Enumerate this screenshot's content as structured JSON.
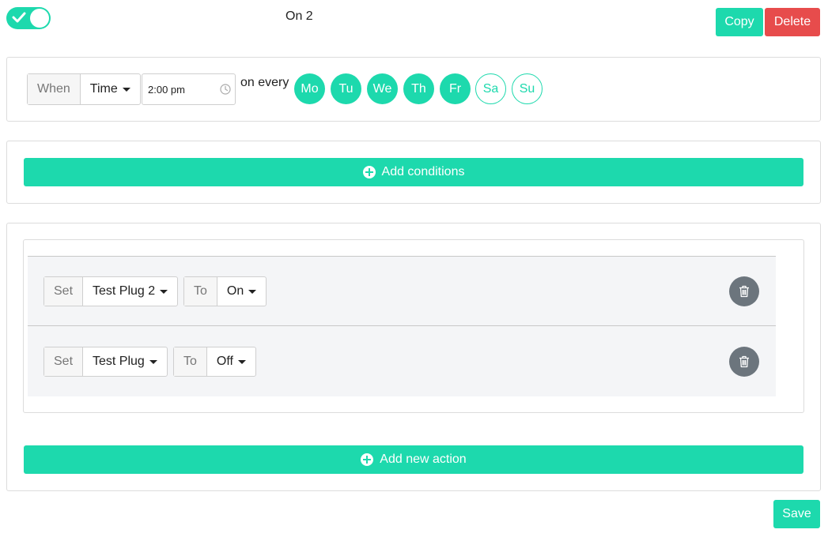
{
  "header": {
    "enabled": true,
    "rule_name": "On 2",
    "copy_label": "Copy",
    "delete_label": "Delete"
  },
  "trigger": {
    "when_label": "When",
    "type_value": "Time",
    "time_value": "2:00 pm",
    "on_every_label": "on every",
    "days": [
      {
        "label": "Mo",
        "selected": true
      },
      {
        "label": "Tu",
        "selected": true
      },
      {
        "label": "We",
        "selected": true
      },
      {
        "label": "Th",
        "selected": true
      },
      {
        "label": "Fr",
        "selected": true
      },
      {
        "label": "Sa",
        "selected": false
      },
      {
        "label": "Su",
        "selected": false
      }
    ]
  },
  "conditions": {
    "add_label": "Add conditions"
  },
  "actions": {
    "items": [
      {
        "set_label": "Set",
        "device": "Test Plug 2",
        "to_label": "To",
        "state": "On"
      },
      {
        "set_label": "Set",
        "device": "Test Plug",
        "to_label": "To",
        "state": "Off"
      }
    ],
    "add_label": "Add new action"
  },
  "footer": {
    "save_label": "Save"
  },
  "colors": {
    "accent": "#1dd9ad",
    "danger": "#e74c4c",
    "icon_button": "#6c757d"
  },
  "icons": {
    "toggle": "check-icon",
    "clock": "clock-icon",
    "add": "plus-circle-icon",
    "remove": "trash-icon"
  }
}
